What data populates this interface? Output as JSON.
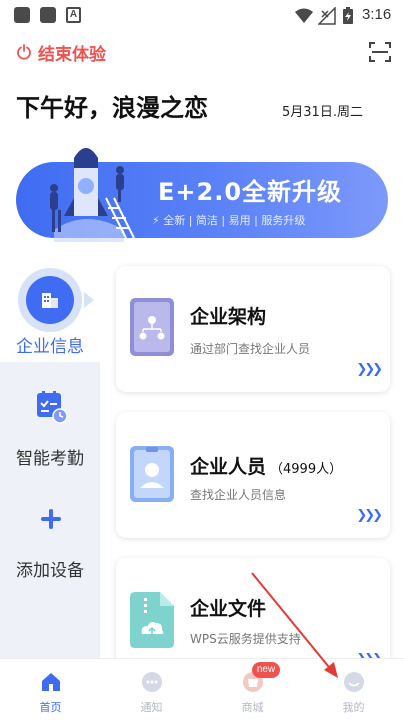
{
  "status_bar": {
    "time": "3:16",
    "a_icon": "A"
  },
  "header": {
    "end_experience": "结束体验",
    "greeting": "下午好，浪漫之恋",
    "date": "5月31日.周二"
  },
  "banner": {
    "title": "E+2.0全新升级",
    "subtitle": "全新 | 简洁 | 易用 | 服务升级"
  },
  "left_nav": [
    {
      "label": "企业信息",
      "active": true,
      "icon": "building-icon"
    },
    {
      "label": "智能考勤",
      "active": false,
      "icon": "attendance-icon"
    },
    {
      "label": "添加设备",
      "active": false,
      "icon": "plus-icon"
    }
  ],
  "cards": [
    {
      "title": "企业架构",
      "count": "",
      "desc": "通过部门查找企业人员",
      "icon": "org-chart-icon"
    },
    {
      "title": "企业人员",
      "count": "（4999人）",
      "desc": "查找企业人员信息",
      "icon": "person-card-icon"
    },
    {
      "title": "企业文件",
      "count": "",
      "desc": "WPS云服务提供支持",
      "icon": "cloud-file-icon"
    }
  ],
  "bottom_nav": [
    {
      "label": "首页",
      "active": true,
      "icon": "home-icon"
    },
    {
      "label": "通知",
      "active": false,
      "icon": "chat-icon"
    },
    {
      "label": "商城",
      "active": false,
      "icon": "shop-icon",
      "badge": "new"
    },
    {
      "label": "我的",
      "active": false,
      "icon": "profile-icon"
    }
  ],
  "colors": {
    "accent": "#3f6cf2",
    "danger": "#ef5350"
  }
}
